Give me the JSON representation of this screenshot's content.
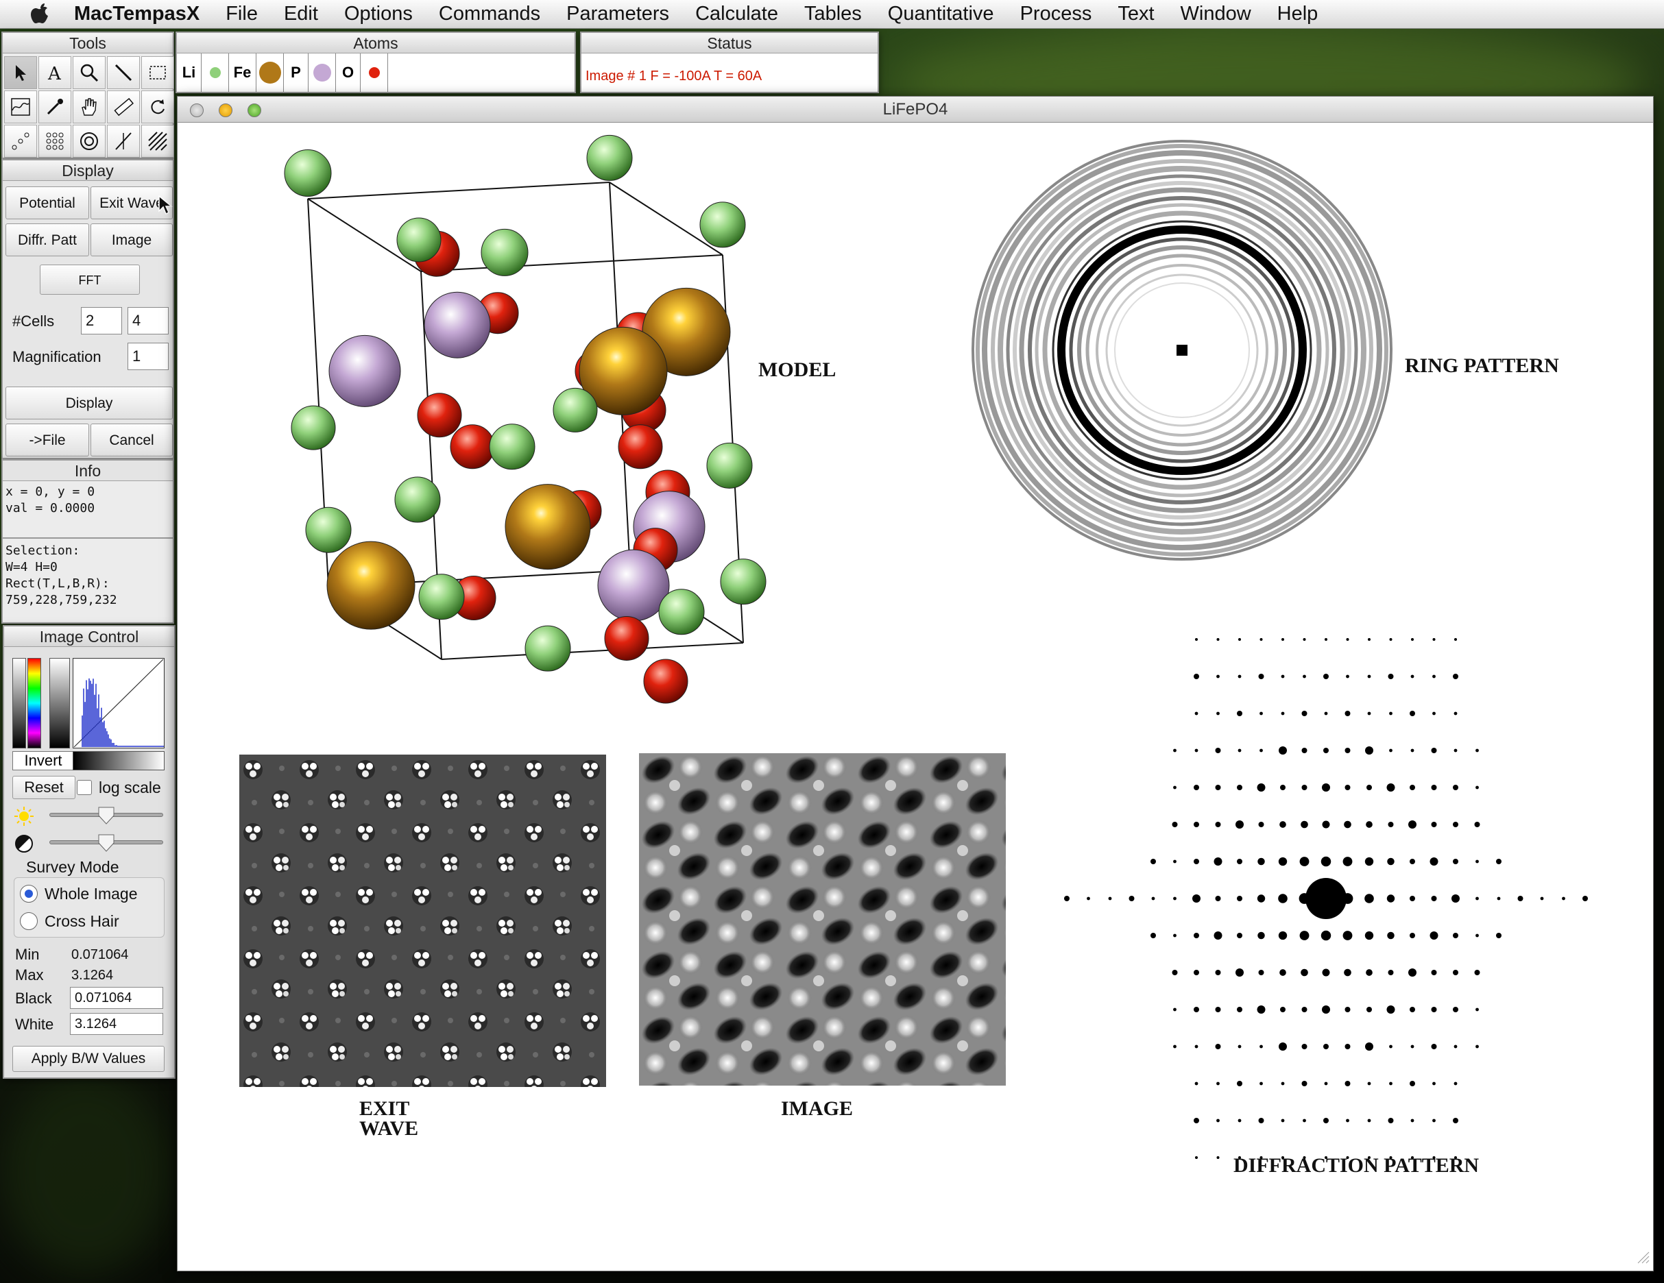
{
  "menubar": {
    "app_name": "MacTempasX",
    "items": [
      "File",
      "Edit",
      "Options",
      "Commands",
      "Parameters",
      "Calculate",
      "Tables",
      "Quantitative",
      "Process",
      "Text",
      "Window",
      "Help"
    ]
  },
  "tools": {
    "title": "Tools"
  },
  "display": {
    "title": "Display",
    "potential": "Potential",
    "exit_wave": "Exit Wave",
    "diffr_patt": "Diffr. Patt",
    "image": "Image",
    "fft": "FFT",
    "cells_label": "#Cells",
    "cells_a": "2",
    "cells_b": "4",
    "magnification_label": "Magnification",
    "magnification": "1",
    "display_button": "Display",
    "to_file": "->File",
    "cancel": "Cancel"
  },
  "info": {
    "title": "Info",
    "coords": "x = 0, y = 0",
    "val": "val = 0.0000",
    "selection": "Selection:",
    "wh": "W=4 H=0",
    "rect_label": "Rect(T,L,B,R):",
    "rect": "759,228,759,232"
  },
  "image_control": {
    "title": "Image Control",
    "invert": "Invert",
    "reset": "Reset",
    "log_scale": "log scale",
    "survey_mode": "Survey Mode",
    "whole_image": "Whole Image",
    "cross_hair": "Cross Hair",
    "min_label": "Min",
    "min": "0.071064",
    "max_label": "Max",
    "max": "3.1264",
    "black_label": "Black",
    "black": "0.071064",
    "white_label": "White",
    "white": "3.1264",
    "apply": "Apply B/W Values"
  },
  "atoms": {
    "title": "Atoms",
    "items": [
      {
        "symbol": "Li",
        "color": "#8fd07a"
      },
      {
        "symbol": "Fe",
        "color": "#b07818"
      },
      {
        "symbol": "P",
        "color": "#c4a8d4"
      },
      {
        "symbol": "O",
        "color": "#e0220e"
      }
    ]
  },
  "status": {
    "title": "Status",
    "text": "Image # 1 F = -100A T = 60A",
    "color": "#cc1a00"
  },
  "window": {
    "title": "LiFePO4",
    "labels": {
      "model": "MODEL",
      "ring": "RING PATTERN",
      "exit_wave_1": "EXIT",
      "exit_wave_2": "WAVE",
      "image": "IMAGE",
      "diffraction": "DIFFRACTION PATTERN"
    }
  }
}
